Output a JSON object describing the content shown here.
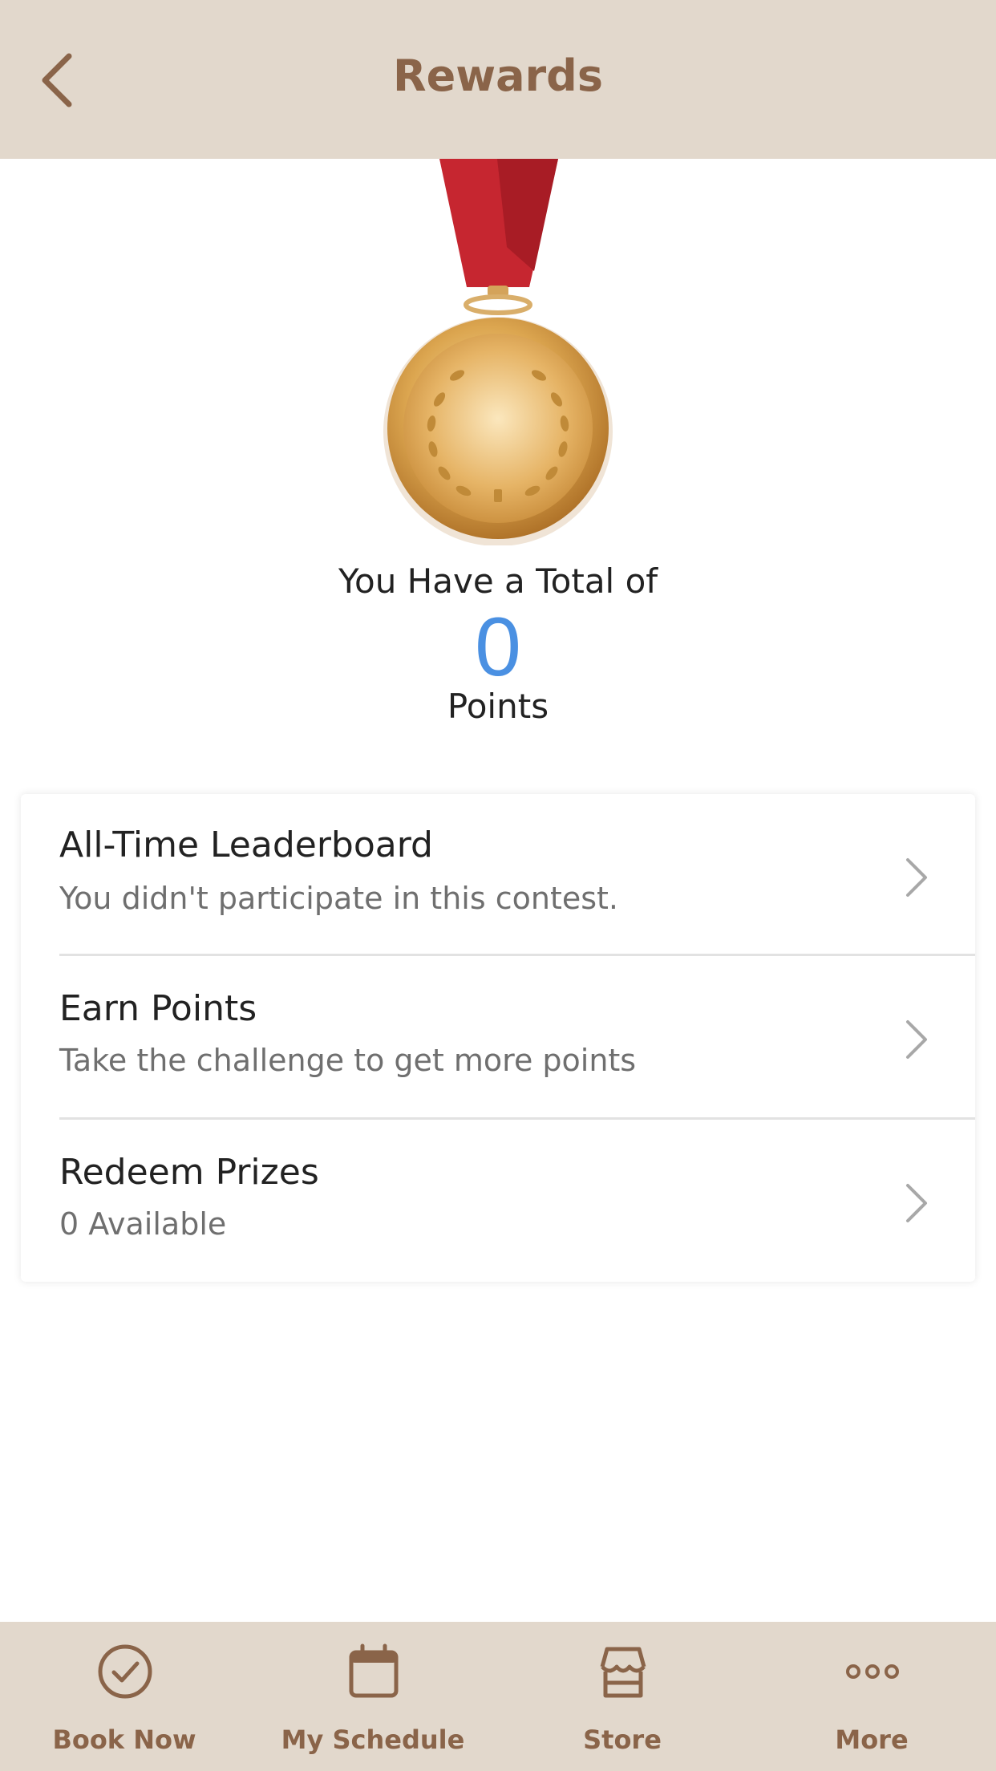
{
  "header": {
    "title": "Rewards",
    "back_icon": "chevron-left-icon"
  },
  "medal": {
    "icon": "gold-medal-icon"
  },
  "summary": {
    "total_label": "You Have a Total of",
    "points_value": "0",
    "points_label": "Points",
    "points_color": "#4a90e2"
  },
  "menu": {
    "items": [
      {
        "title": "All-Time Leaderboard",
        "subtitle": "You didn't participate in this contest."
      },
      {
        "title": "Earn Points",
        "subtitle": "Take the challenge to get more points"
      },
      {
        "title": "Redeem Prizes",
        "subtitle": "0 Available"
      }
    ]
  },
  "tabbar": {
    "items": [
      {
        "label": "Book Now",
        "icon": "check-circle-icon"
      },
      {
        "label": "My Schedule",
        "icon": "calendar-icon"
      },
      {
        "label": "Store",
        "icon": "store-icon"
      },
      {
        "label": "More",
        "icon": "more-dots-icon"
      }
    ]
  },
  "colors": {
    "brand": "#8a6449",
    "bar_background": "#e2d8cc",
    "accent": "#4a90e2"
  }
}
